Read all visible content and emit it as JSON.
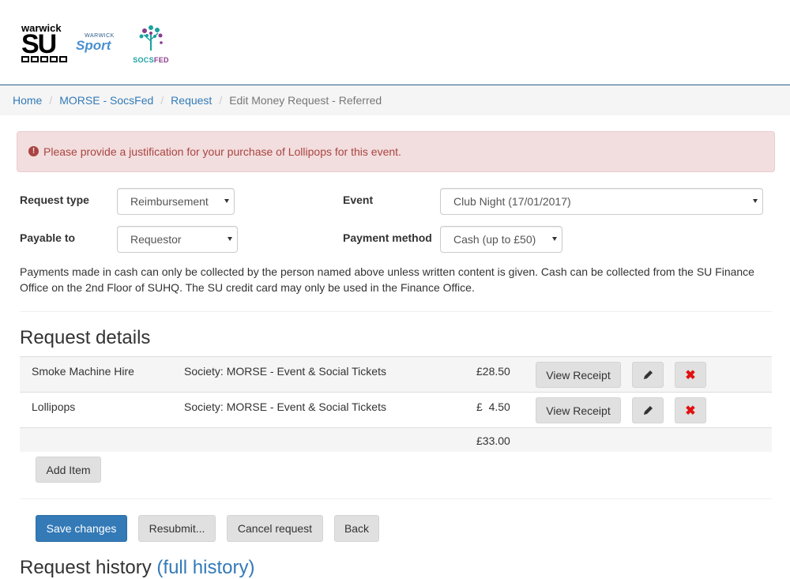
{
  "logos": {
    "su_top": "warwick",
    "su_main": "SU",
    "sport_small": "WARWICK",
    "sport_big": "Sport",
    "socs_a": "SOCS",
    "socs_b": "FED"
  },
  "breadcrumb": {
    "home": "Home",
    "society": "MORSE - SocsFed",
    "request": "Request",
    "current": "Edit Money Request - Referred",
    "sep": "/"
  },
  "alert": {
    "icon": "exclamation-circle-icon",
    "text": "Please provide a justification for your purchase of Lollipops for this event."
  },
  "form": {
    "request_type_label": "Request type",
    "request_type_value": "Reimbursement",
    "event_label": "Event",
    "event_value": "Club Night (17/01/2017)",
    "payable_to_label": "Payable to",
    "payable_to_value": "Requestor",
    "payment_method_label": "Payment method",
    "payment_method_value": "Cash (up to £50)"
  },
  "note": "Payments made in cash can only be collected by the person named above unless written content is given. Cash can be collected from the SU Finance Office on the 2nd Floor of SUHQ. The SU credit card may only be used in the Finance Office.",
  "details": {
    "title": "Request details",
    "items": [
      {
        "name": "Smoke Machine Hire",
        "budget": "Society: MORSE - Event & Social Tickets",
        "amount": "£28.50",
        "receipt": "View Receipt"
      },
      {
        "name": "Lollipops",
        "budget": "Society: MORSE - Event & Social Tickets",
        "amount": "£  4.50",
        "receipt": "View Receipt"
      }
    ],
    "total": "£33.00",
    "add_item": "Add Item"
  },
  "actions": {
    "save": "Save changes",
    "resubmit": "Resubmit...",
    "cancel": "Cancel request",
    "back": "Back"
  },
  "history": {
    "title": "Request history",
    "link": "(full history)"
  },
  "colors": {
    "link": "#337ab7",
    "alert_bg": "#f2dede",
    "alert_text": "#a94442",
    "primary": "#337ab7",
    "delete": "#e01010"
  }
}
